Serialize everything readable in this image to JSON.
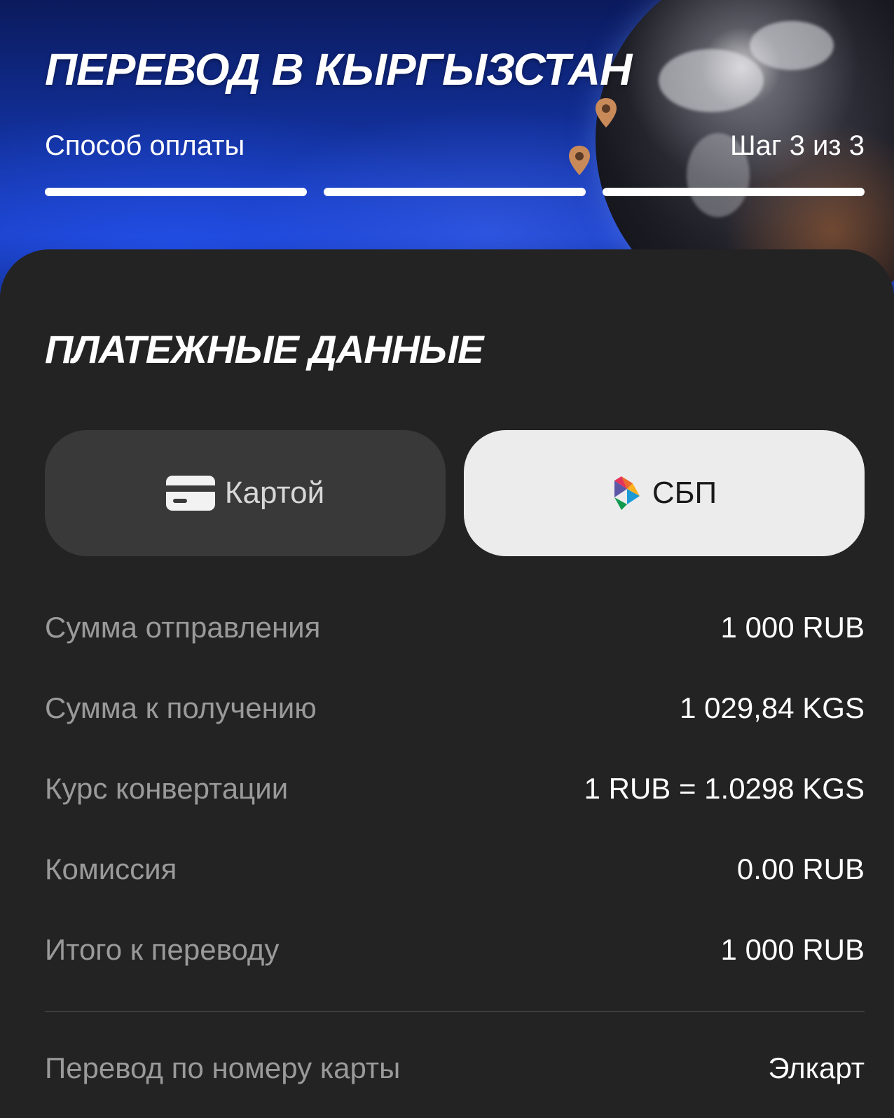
{
  "header": {
    "title": "ПЕРЕВОД В КЫРГЫЗСТАН",
    "step_label": "Способ оплаты",
    "step_count": "Шаг 3 из 3",
    "progress_completed": 3,
    "progress_total": 3
  },
  "payment": {
    "section_title": "ПЛАТЕЖНЫЕ ДАННЫЕ",
    "methods": [
      {
        "label": "Картой",
        "icon": "credit-card-icon",
        "selected": false
      },
      {
        "label": "СБП",
        "icon": "sbp-logo-icon",
        "selected": true
      }
    ]
  },
  "details": [
    {
      "label": "Сумма отправления",
      "value": "1 000 RUB"
    },
    {
      "label": "Сумма к получению",
      "value": "1 029,84 KGS"
    },
    {
      "label": "Курс конвертации",
      "value": "1 RUB = 1.0298 KGS"
    },
    {
      "label": "Комиссия",
      "value": "0.00 RUB"
    },
    {
      "label": "Итого к переводу",
      "value": "1 000 RUB"
    }
  ],
  "transfer": {
    "label": "Перевод по номеру карты",
    "value": "Элкарт"
  },
  "colors": {
    "background": "#232323",
    "hero_blue": "#1a3fc4",
    "selected_button": "#ececec",
    "unselected_button": "#393939",
    "label_gray": "#9a9a9a"
  }
}
